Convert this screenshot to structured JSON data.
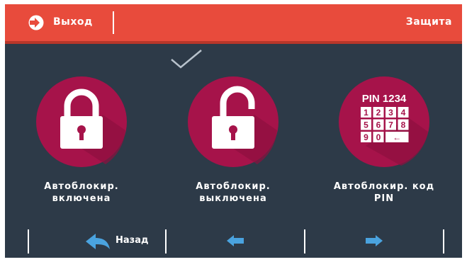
{
  "header": {
    "exit_label": "Выход",
    "title": "Защита"
  },
  "options": [
    {
      "label": "Автоблокир. включена",
      "icon": "lock-closed-icon",
      "selected": true
    },
    {
      "label": "Автоблокир. выключена",
      "icon": "lock-open-icon",
      "selected": false
    },
    {
      "label": "Автоблокир. код PIN",
      "icon": "pin-keypad-icon",
      "selected": false
    }
  ],
  "keypad": {
    "title": "PIN 1234",
    "keys": [
      "1",
      "2",
      "3",
      "4",
      "5",
      "6",
      "7",
      "8",
      "9",
      "0",
      "←"
    ]
  },
  "footer": {
    "back_label": "Назад"
  },
  "colors": {
    "header": "#e84b3c",
    "background": "#2d3a48",
    "circle": "#a6134a",
    "arrow": "#4aa3df"
  }
}
